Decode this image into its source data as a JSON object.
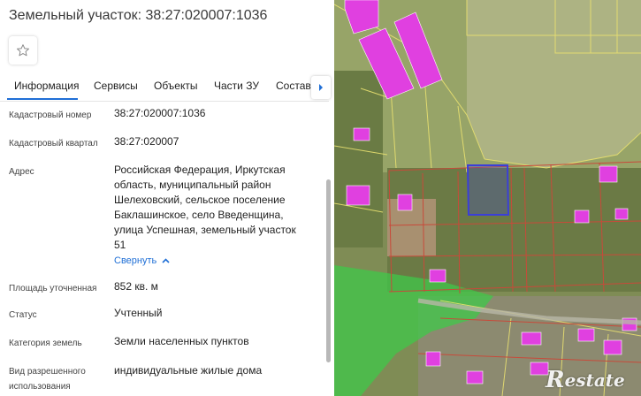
{
  "header": {
    "title": "Земельный участок: 38:27:020007:1036"
  },
  "tabs": [
    {
      "label": "Информация"
    },
    {
      "label": "Сервисы"
    },
    {
      "label": "Объекты"
    },
    {
      "label": "Части ЗУ"
    },
    {
      "label": "Состав"
    }
  ],
  "info": {
    "cadastral_number": {
      "label": "Кадастровый номер",
      "value": "38:27:020007:1036"
    },
    "cadastral_quarter": {
      "label": "Кадастровый квартал",
      "value": "38:27:020007"
    },
    "address": {
      "label": "Адрес",
      "lines": [
        "Российская Федерация, Иркутская",
        "область, муниципальный район",
        "Шелеховский, сельское поселение",
        "Баклашинское, село Введенщина,",
        "улица Успешная, земельный участок",
        "51"
      ],
      "collapse_label": "Свернуть"
    },
    "area": {
      "label": "Площадь уточненная",
      "value": "852 кв. м"
    },
    "status": {
      "label": "Статус",
      "value": "Учтенный"
    },
    "land_category": {
      "label": "Категория земель",
      "value": "Земли населенных пунктов"
    },
    "permitted_use": {
      "label_line1": "Вид разрешенного",
      "label_line2": "использования",
      "value": "индивидуальные жилые дома"
    }
  },
  "map": {
    "watermark_letter": "R",
    "watermark_text": "estate"
  },
  "colors": {
    "accent": "#1f6fd6",
    "building": "#e040e0",
    "forest_zone": "#3fc84a",
    "parcel_highlight": "#3b3fd8"
  },
  "icons": {
    "favorite": "star-icon",
    "tabs_next": "chevron-right-icon",
    "collapse": "chevron-up-icon"
  }
}
